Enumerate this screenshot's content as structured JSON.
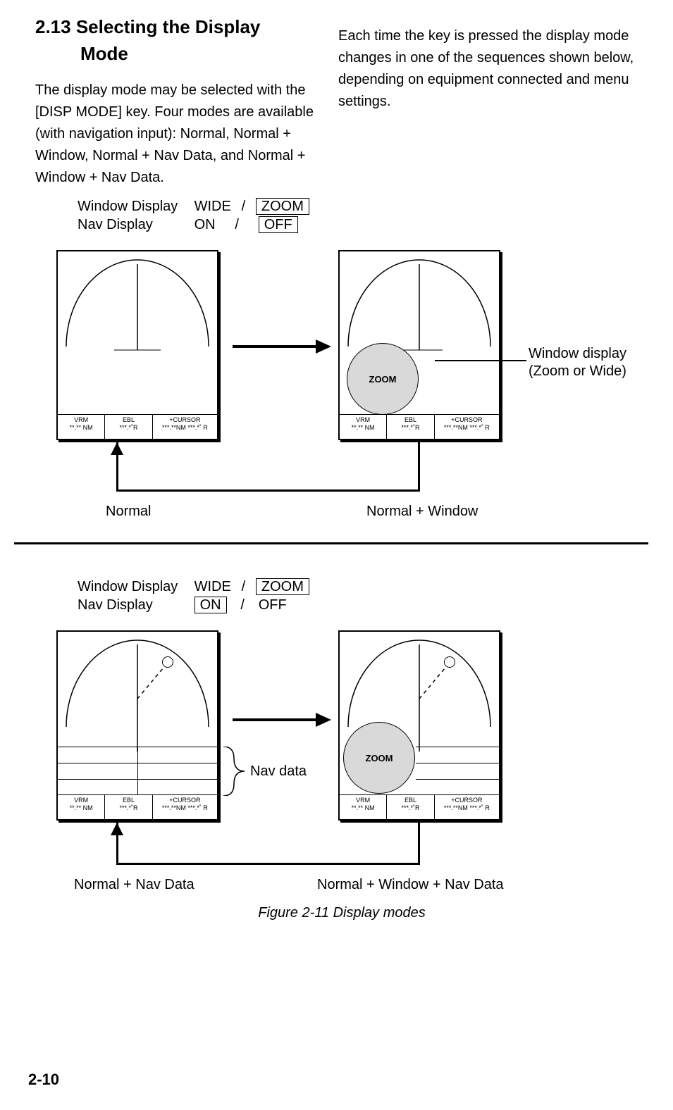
{
  "heading": {
    "number": "2.13",
    "title_line1": "Selecting the Display",
    "title_line2": "Mode"
  },
  "para_left": "The display mode may be selected with the [DISP MODE] key. Four modes are available (with navigation input): Normal, Normal + Window, Normal + Nav Data, and Normal + Window + Nav Data.",
  "para_right": "Each time the key is pressed the display mode changes in one of the sequences shown below, depending on equipment connected and menu settings.",
  "options": {
    "window_label": "Window Display",
    "nav_label": "Nav Display",
    "wide": "WIDE",
    "on": "ON",
    "zoom": "ZOOM",
    "off": "OFF"
  },
  "panel_footer": {
    "vrm_h": "VRM",
    "vrm_v": "**.** NM",
    "ebl_h": "EBL",
    "ebl_v": "***.*˚R",
    "cur_h": "+CURSOR",
    "cur_v": "***.**NM ***.*˚ R"
  },
  "zoom_label": "ZOOM",
  "labels": {
    "normal": "Normal",
    "normal_window": "Normal + Window",
    "normal_nav": "Normal + Nav Data",
    "normal_window_nav": "Normal + Window + Nav Data",
    "window_display": "Window display",
    "zoom_or_wide": "(Zoom or Wide)",
    "nav_data": "Nav data"
  },
  "figure_caption": "Figure 2-11 Display modes",
  "page_number": "2-10"
}
